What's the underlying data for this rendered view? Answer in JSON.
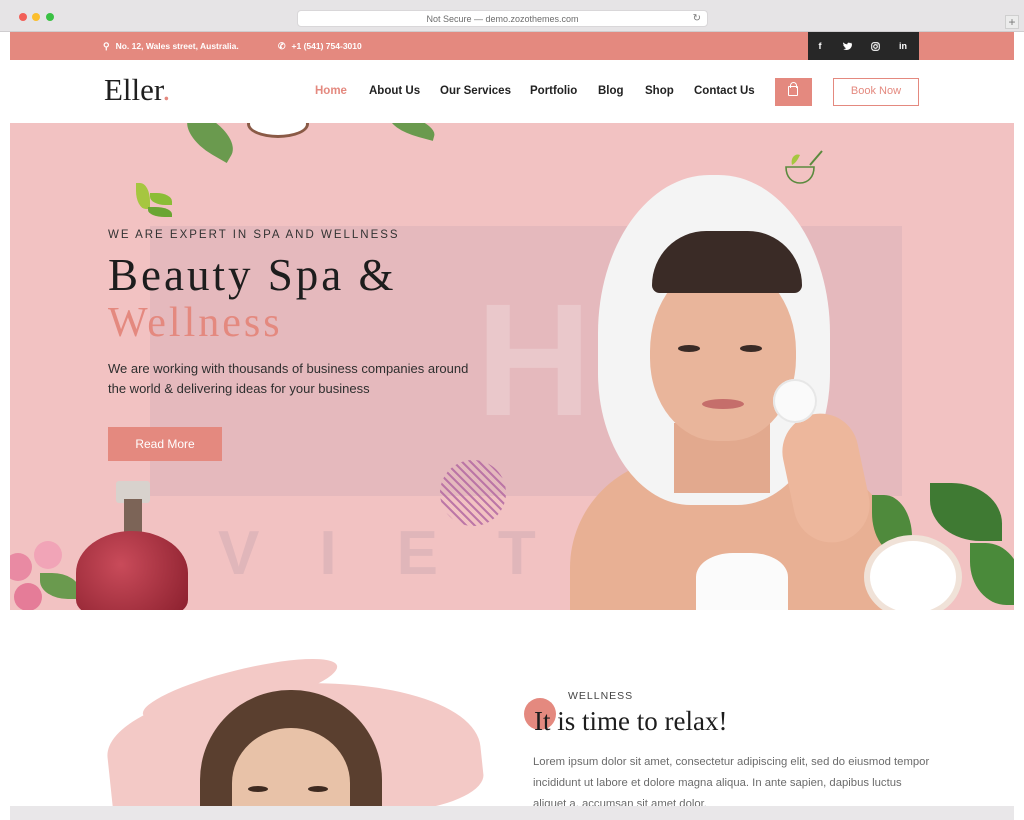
{
  "browser": {
    "url": "Not Secure — demo.zozothemes.com",
    "new_tab": "+"
  },
  "topbar": {
    "address": "No. 12, Wales street, Australia.",
    "phone": "+1 (541) 754-3010",
    "social": [
      "f",
      "t",
      "ig",
      "in"
    ]
  },
  "header": {
    "logo": "Eller",
    "logo_dot": ".",
    "nav": [
      "Home",
      "About Us",
      "Our Services",
      "Portfolio",
      "Blog",
      "Shop",
      "Contact Us"
    ],
    "book_label": "Book Now"
  },
  "hero": {
    "eyebrow": "WE ARE EXPERT IN SPA AND WELLNESS",
    "title_line1": "Beauty Spa &",
    "title_line2": "Wellness",
    "lead": "We are working with thousands of business companies around the world & delivering ideas for your business",
    "cta": "Read More",
    "watermark_top": "H",
    "watermark_bottom": "VIETN"
  },
  "about": {
    "tag": "WELLNESS",
    "title": "It is time to relax!",
    "text": "Lorem ipsum dolor sit amet, consectetur adipiscing elit, sed do eiusmod tempor incididunt ut labore et dolore magna aliqua. In ante sapien, dapibus luctus aliquet a, accumsan sit amet dolor."
  },
  "colors": {
    "accent": "#e4897f",
    "hero_bg": "#f2c2c2",
    "dark": "#272727"
  }
}
